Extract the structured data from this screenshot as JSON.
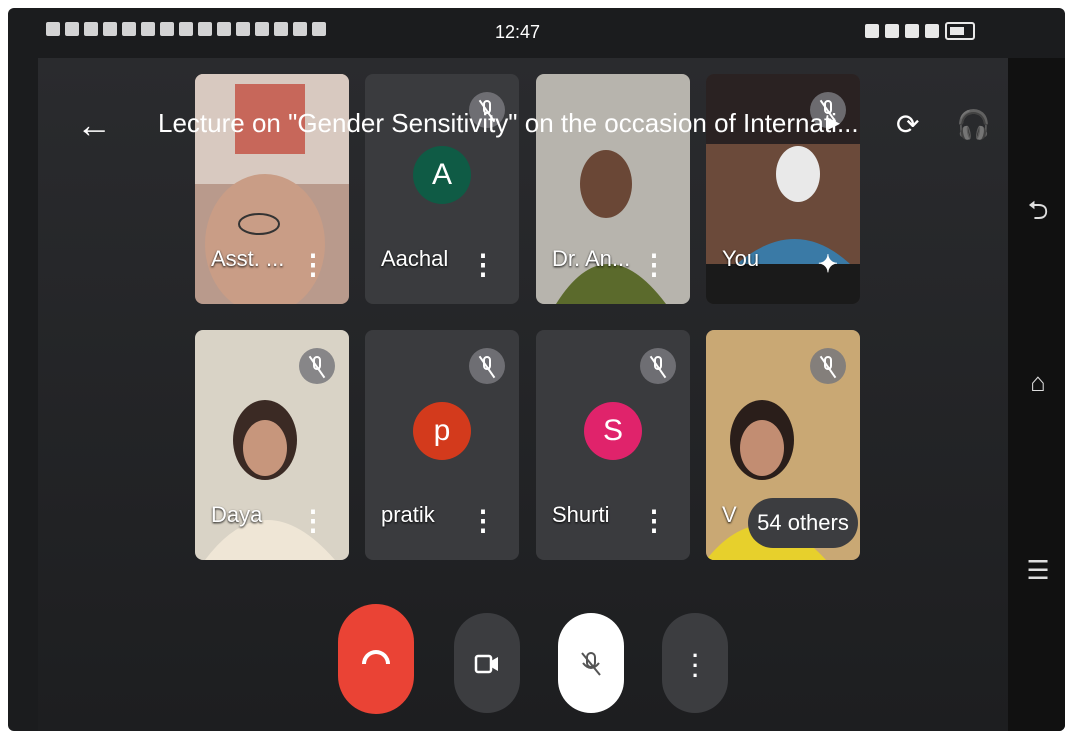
{
  "status_bar": {
    "time": "12:47"
  },
  "meeting": {
    "title": "Lecture on \"Gender Sensitivity\" on the occasion of Internati..."
  },
  "participants": [
    {
      "name": "Asst. ...",
      "muted": false
    },
    {
      "name": "Aachal",
      "initial": "A",
      "avatar_color": "#0f5b45",
      "muted": true
    },
    {
      "name": "Dr. An...",
      "muted": false
    },
    {
      "name": "You",
      "muted": true
    },
    {
      "name": "Daya",
      "muted": true
    },
    {
      "name": "pratik",
      "initial": "p",
      "avatar_color": "#d33a1c",
      "muted": true
    },
    {
      "name": "Shurti",
      "initial": "S",
      "avatar_color": "#e0236b",
      "muted": true
    },
    {
      "name": "V",
      "muted": true
    }
  ],
  "others_label": "54 others",
  "icons": {
    "back": "arrow-left-icon",
    "switch_camera": "switch-camera-icon",
    "audio": "headphones-icon",
    "hangup": "phone-hangup-icon",
    "camera": "camera-icon",
    "mic": "mic-off-icon",
    "more": "more-vert-icon",
    "nav_back": "nav-back-icon",
    "nav_home": "nav-home-icon",
    "nav_menu": "nav-menu-icon"
  },
  "colors": {
    "hangup": "#ea4335",
    "background": "#1b1c1e"
  }
}
